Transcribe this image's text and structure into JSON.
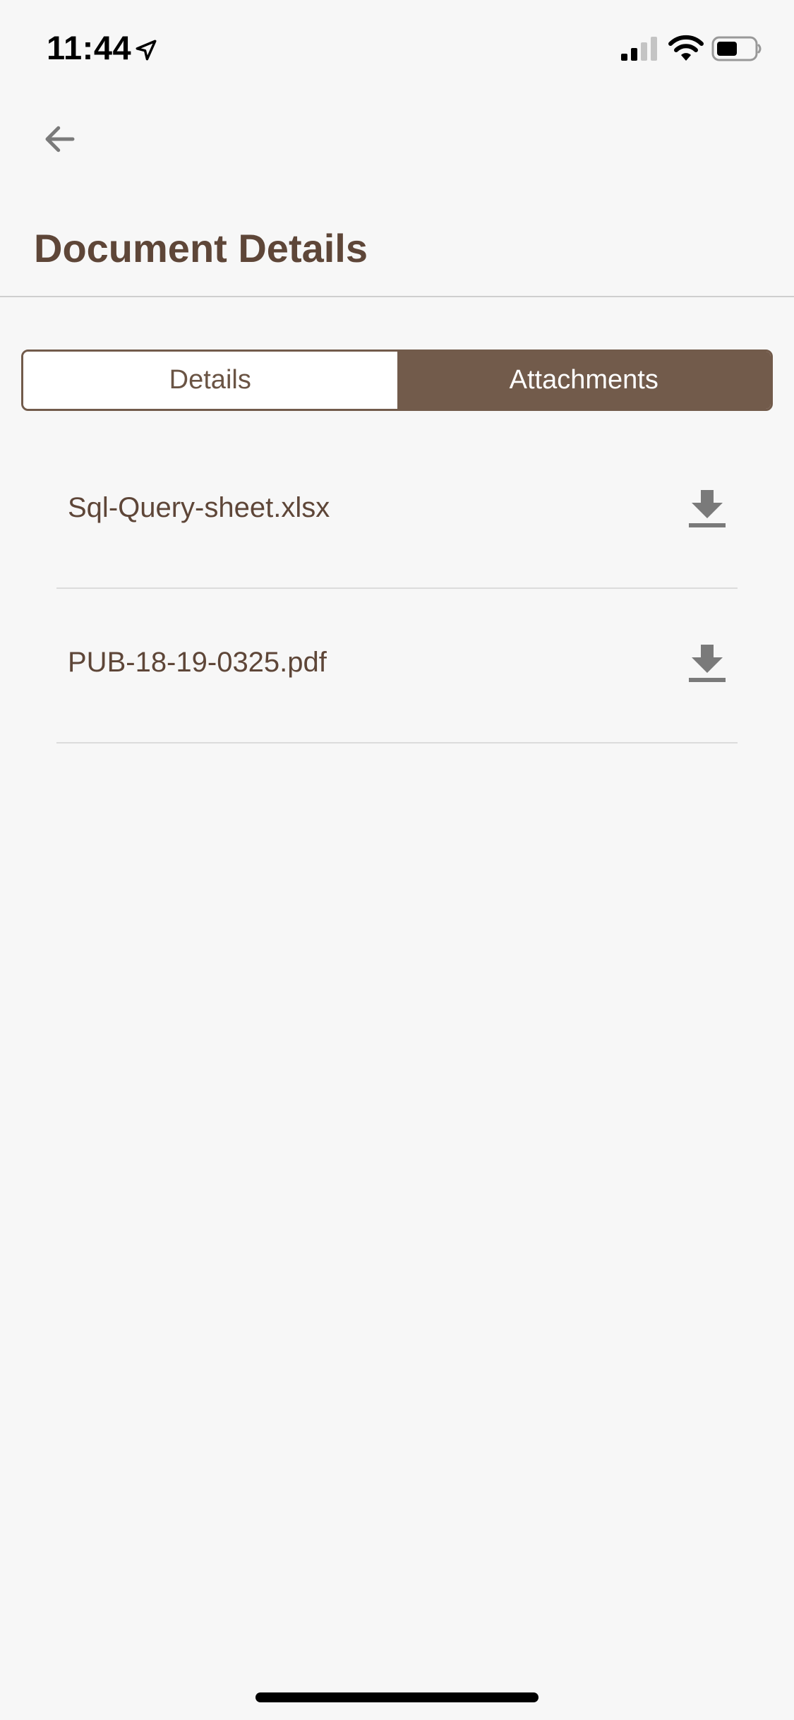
{
  "status_bar": {
    "time": "11:44",
    "icons": [
      "location-arrow-icon",
      "cellular-signal-icon",
      "wifi-icon",
      "battery-icon"
    ]
  },
  "header": {
    "back_icon": "arrow-left-icon",
    "title": "Document Details"
  },
  "tabs": [
    {
      "label": "Details",
      "active": false
    },
    {
      "label": "Attachments",
      "active": true
    }
  ],
  "attachments": [
    {
      "name": "Sql-Query-sheet.xlsx",
      "action_icon": "download-icon"
    },
    {
      "name": "PUB-18-19-0325.pdf",
      "action_icon": "download-icon"
    }
  ],
  "colors": {
    "brand": "#725b4b",
    "title_text": "#5e4638",
    "background": "#f7f7f7",
    "icon_gray": "#7a7a7a",
    "divider": "#dcdcdc"
  }
}
